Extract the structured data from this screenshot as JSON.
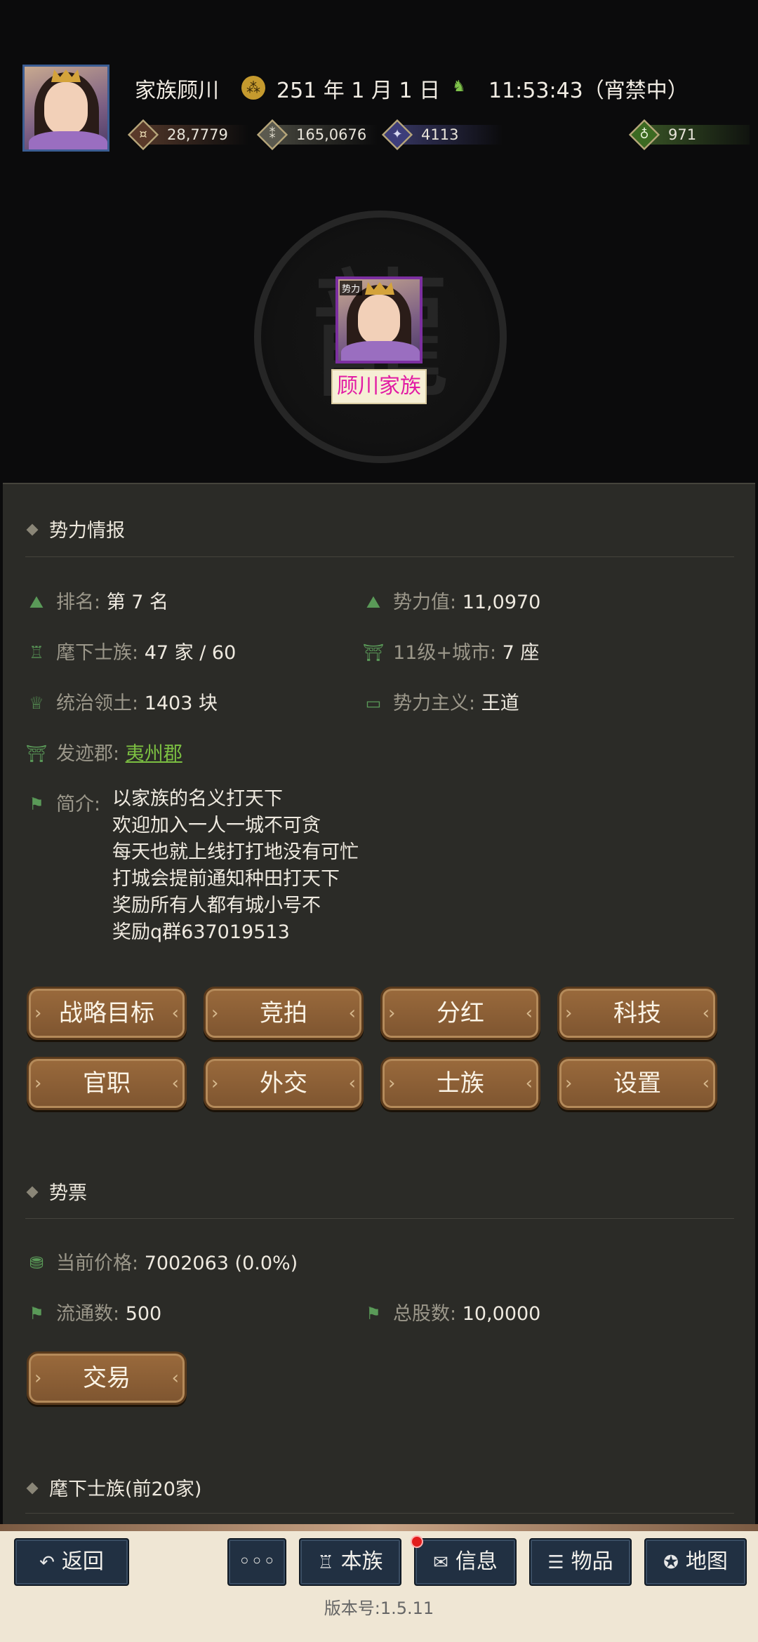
{
  "header": {
    "player_name": "家族顾川",
    "date_icon": "calendar-icon",
    "date": "251 年 1 月 1 日",
    "time_icon": "horse-icon",
    "time": "11:53:43（宵禁中）",
    "resources": [
      {
        "name": "coin-icon",
        "value": "28,7779"
      },
      {
        "name": "grain-icon",
        "value": "165,0676"
      },
      {
        "name": "soldier-icon",
        "value": "4113"
      },
      {
        "name": "pouch-icon",
        "value": "971"
      }
    ]
  },
  "emblem": {
    "card_tag": "势力",
    "faction_name": "顾川家族"
  },
  "info": {
    "title": "势力情报",
    "rank_label": "排名:",
    "rank_value": "第 7 名",
    "power_label": "势力值:",
    "power_value": "11,0970",
    "clans_label": "麾下士族:",
    "clans_value": "47 家 / 60",
    "cities_label": "11级+城市:",
    "cities_value": "7 座",
    "territory_label": "统治领土:",
    "territory_value": "1403 块",
    "doctrine_label": "势力主义:",
    "doctrine_value": "王道",
    "origin_label": "发迹郡:",
    "origin_value": "夷州郡",
    "intro_label": "简介:",
    "intro_lines": [
      "以家族的名义打天下",
      "欢迎加入一人一城不可贪",
      "每天也就上线打打地没有可忙",
      "打城会提前通知种田打天下",
      "奖励所有人都有城小号不",
      "奖励q群637019513"
    ]
  },
  "actions": [
    "战略目标",
    "竞拍",
    "分红",
    "科技",
    "官职",
    "外交",
    "士族",
    "设置"
  ],
  "stock": {
    "title": "势票",
    "price_label": "当前价格:",
    "price_value": "7002063 (0.0%)",
    "float_label": "流通数:",
    "float_value": "500",
    "total_label": "总股数:",
    "total_value": "10,0000",
    "trade_button": "交易"
  },
  "clans_section": {
    "title": "麾下士族(前20家)"
  },
  "nav": {
    "back": "返回",
    "more": "◦◦◦",
    "clan": "本族",
    "message": "信息",
    "items": "物品",
    "map": "地图"
  },
  "version": "版本号:1.5.11",
  "colors": {
    "panel_bg": "#2b2b27",
    "button_brown": "#8a5f36",
    "link_green": "#7cc042",
    "faction_pink": "#e21ca4",
    "nav_blue": "#213042"
  }
}
